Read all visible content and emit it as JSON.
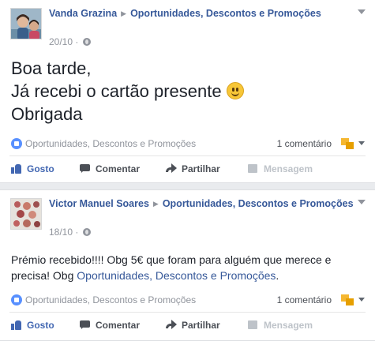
{
  "posts": [
    {
      "author": "Vanda Grazina",
      "group": "Oportunidades, Descontos e Promoções",
      "date": "20/10",
      "message_lines": [
        "Boa tarde,",
        "Já recebi o cartão presente",
        "Obrigada"
      ],
      "message_emoji": "smiley-icon",
      "reaction_text": "Oportunidades, Descontos e Promoções",
      "comment_count": "1 comentário",
      "actions": {
        "like": "Gosto",
        "comment": "Comentar",
        "share": "Partilhar",
        "message": "Mensagem"
      }
    },
    {
      "author": "Victor Manuel Soares",
      "group": "Oportunidades, Descontos e Promoções",
      "date": "18/10",
      "message_text": "Prémio recebido!!!! Obg 5€ que foram para alguém que merece e precisa! Obg ",
      "message_link": "Oportunidades, Descontos e Promoções",
      "message_end": ".",
      "reaction_text": "Oportunidades, Descontos e Promoções",
      "comment_count": "1 comentário",
      "actions": {
        "like": "Gosto",
        "comment": "Comentar",
        "share": "Partilhar",
        "message": "Mensagem"
      }
    }
  ],
  "colors": {
    "link": "#365899",
    "like_active": "#4267b2",
    "meta": "#90949c",
    "background": "#e9ebee"
  }
}
